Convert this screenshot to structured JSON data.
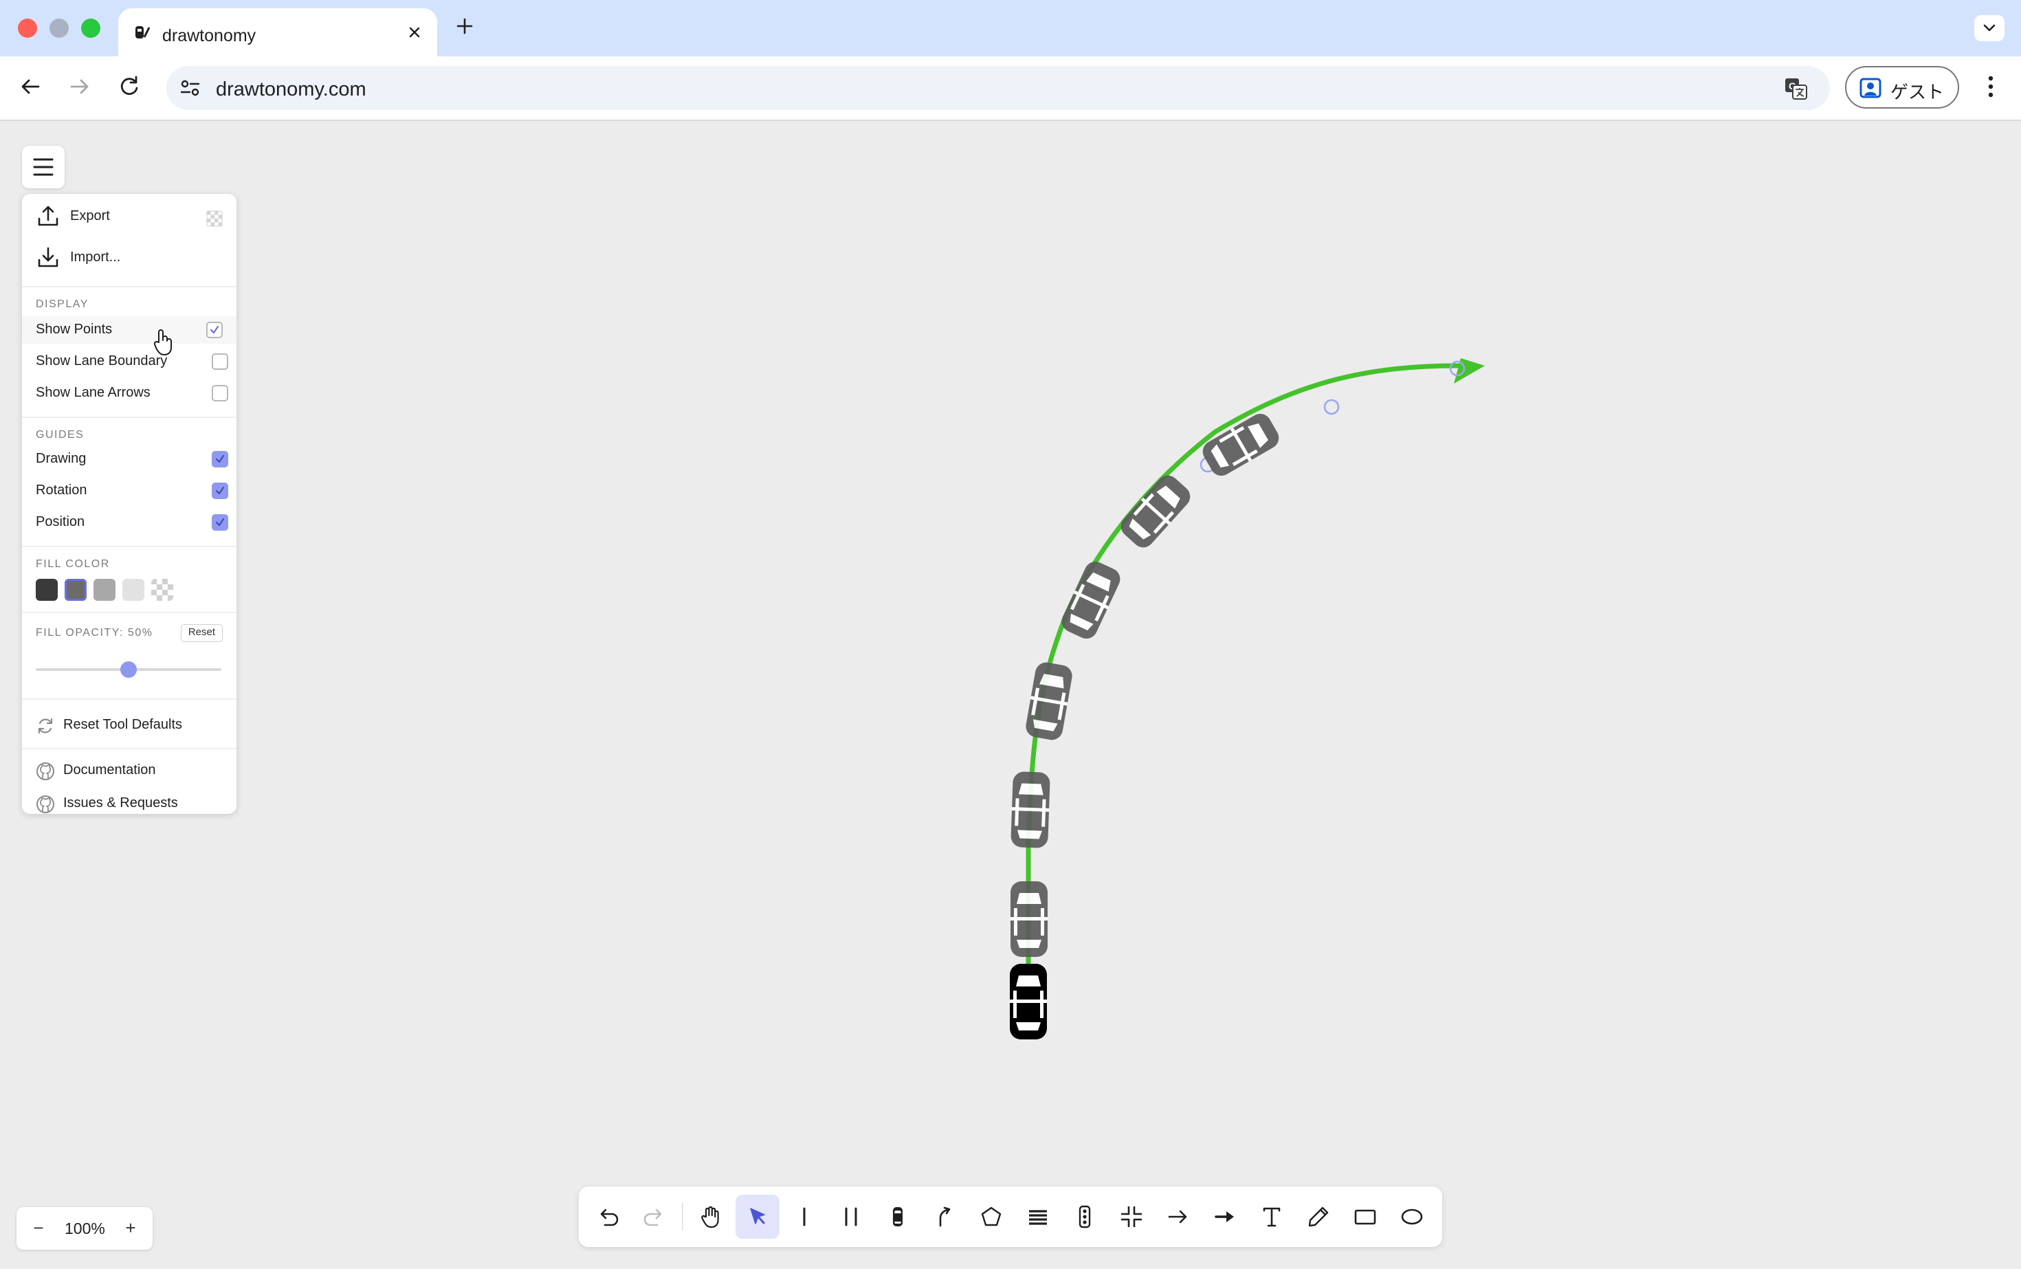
{
  "browser": {
    "tab_title": "drawtonomy",
    "url": "drawtonomy.com",
    "profile_label": "ゲスト"
  },
  "menu": {
    "export_label": "Export",
    "import_label": "Import...",
    "display_heading": "DISPLAY",
    "display_items": [
      {
        "label": "Show Points",
        "checked": true
      },
      {
        "label": "Show Lane Boundary",
        "checked": false
      },
      {
        "label": "Show Lane Arrows",
        "checked": false
      }
    ],
    "guides_heading": "GUIDES",
    "guide_items": [
      {
        "label": "Drawing",
        "checked": true
      },
      {
        "label": "Rotation",
        "checked": true
      },
      {
        "label": "Position",
        "checked": true
      }
    ],
    "fill_color_heading": "FILL COLOR",
    "fill_colors": [
      "#3a3a3a",
      "#6b6b6b",
      "#a8a8a8",
      "#e2e2e2",
      "transparent"
    ],
    "fill_color_selected_index": 1,
    "fill_opacity_label": "FILL OPACITY: 50%",
    "fill_opacity_value": 0.5,
    "reset_label": "Reset",
    "reset_defaults_label": "Reset Tool Defaults",
    "documentation_label": "Documentation",
    "issues_label": "Issues & Requests"
  },
  "zoom": {
    "minus": "−",
    "value": "100%",
    "plus": "+"
  },
  "colors": {
    "accent": "#8f98ef",
    "path_green": "#44c22b",
    "vehicle_ghost": "#5c5c5c",
    "vehicle_solid": "#000000",
    "canvas_bg": "#ececec"
  },
  "toolbar_tools": [
    {
      "name": "undo-icon"
    },
    {
      "name": "redo-icon"
    },
    {
      "name": "hand-icon"
    },
    {
      "name": "select-arrow-icon",
      "active": true
    },
    {
      "name": "single-lane-icon"
    },
    {
      "name": "double-lane-icon"
    },
    {
      "name": "vehicle-icon"
    },
    {
      "name": "path-icon"
    },
    {
      "name": "polygon-icon"
    },
    {
      "name": "crosswalk-icon"
    },
    {
      "name": "traffic-light-icon"
    },
    {
      "name": "intersection-icon"
    },
    {
      "name": "thin-arrow-icon"
    },
    {
      "name": "thick-arrow-icon"
    },
    {
      "name": "text-icon"
    },
    {
      "name": "pencil-icon"
    },
    {
      "name": "rectangle-icon"
    },
    {
      "name": "ellipse-icon"
    }
  ]
}
